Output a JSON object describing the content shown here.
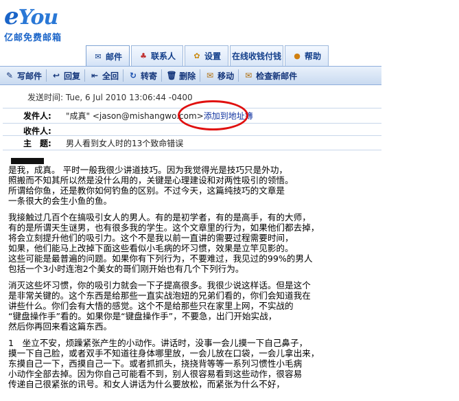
{
  "logo": {
    "main_e": "e",
    "main_you": "You",
    "sub": "亿邮免费邮箱"
  },
  "tabs": [
    {
      "label": "邮件",
      "icon": "mail-icon"
    },
    {
      "label": "联系人",
      "icon": "contacts-icon"
    },
    {
      "label": "设置",
      "icon": "settings-icon"
    },
    {
      "label": "在线收钱付钱",
      "icon": ""
    },
    {
      "label": "帮助",
      "icon": "help-icon"
    }
  ],
  "toolbar": [
    {
      "label": "写邮件",
      "icon": "compose-icon"
    },
    {
      "label": "回复",
      "icon": "reply-icon"
    },
    {
      "label": "全回",
      "icon": "reply-all-icon"
    },
    {
      "label": "转寄",
      "icon": "forward-icon"
    },
    {
      "label": "删除",
      "icon": "delete-icon"
    },
    {
      "label": "移动",
      "icon": "move-icon"
    },
    {
      "label": "检查新邮件",
      "icon": "check-mail-icon"
    }
  ],
  "message": {
    "send_time": "发送时间: Tue, 6 Jul 2010 13:06:44 -0400",
    "from_label": "发件人:",
    "from_value": "\"成真\" <jason@mishangwo.com>",
    "add_contact_link": "添加到地址簿",
    "to_label": "收件人:",
    "to_value": "",
    "subject_label": "主　题:",
    "subject_value": "男人看到女人时的13个致命错误"
  },
  "body": {
    "paragraphs": [
      "是我，成真。 平时一般我很少讲道技巧。因为我觉得光是技巧只是外功，\n照搬而不知其所以然是没什么用的，关键是心理建设和对两性吸引的领悟。\n所谓给你鱼，还是教你如何钓鱼的区别。不过今天，这篇纯技巧的文章是\n一条很大的会生小鱼的鱼。",
      "我接触过几百个在搞吸引女人的男人。有的是初学者，有的是高手，有的大师，\n有的是所谓天生谜男，也有很多我的学生。这个文章里的行为，如果他们都去掉，\n将会立刻提升他们的吸引力。这个不是我以前一直讲的需要过程需要时间，\n如果，他们能马上改掉下面这些看似小毛病的坏习惯，效果是立竿见影的。\n这些可能是最普遍的问题。如果你有下列行为，不要难过，我见过的99%的男人\n包括一个3小时连泡2个美女的哥们刚开始也有几个下列行为。",
      "消灭这些坏习惯，你的吸引力就会一下子提高很多。我很少说这样话。但是这个\n是非常关键的。这个东西是给那些一直实战泡妞的兄弟们看的，你们会知道我在\n讲些什么。你们会有大悟的感觉。这个不是给那些只在家里上网，不实战的\n“键盘操作手”看的。如果你是“键盘操作手”，不要急，出门开始实战，\n然后你再回来看这篇东西。",
      "1　坐立不安，烦躁紧张产生的小动作。讲话时，没事一会儿摸一下自己鼻子，\n摸一下自己脸，或者双手不知道往身体哪里放，一会儿放在口袋，一会儿拿出来，\n东摸自己一下，西摸自己一下。或者抓抓头，挠挠背等等一系列习惯性小毛病\n小动作全部去掉。因为你自己可能看不到，别人很容易看到这些动作，很容易\n传递自己很紧张的讯号。和女人讲话为什么要放松，而紧张为什么不好，"
    ]
  },
  "colors": {
    "accent": "#1a64c8",
    "toolbar": "#c9daf0",
    "highlight_circle": "#e01010",
    "link": "#1033a0"
  }
}
